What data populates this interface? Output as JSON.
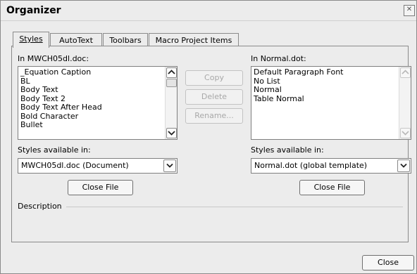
{
  "window": {
    "title": "Organizer",
    "close_icon": "close-icon"
  },
  "tabs": [
    {
      "label": "Styles",
      "active": true
    },
    {
      "label": "AutoText",
      "active": false
    },
    {
      "label": "Toolbars",
      "active": false
    },
    {
      "label": "Macro Project Items",
      "active": false
    }
  ],
  "left": {
    "list_label": "In MWCH05dl.doc:",
    "items": [
      "_Equation Caption",
      "BL",
      "Body Text",
      "Body Text 2",
      "Body Text After Head",
      "Bold Character",
      "Bullet"
    ],
    "available_label": "Styles available in:",
    "available_value": "MWCH05dl.doc (Document)",
    "close_file_label": "Close File"
  },
  "middle": {
    "copy_label": "Copy",
    "delete_label": "Delete",
    "rename_label": "Rename..."
  },
  "right": {
    "list_label": "In Normal.dot:",
    "items": [
      "Default Paragraph Font",
      "No List",
      "Normal",
      "Table Normal"
    ],
    "available_label": "Styles available in:",
    "available_value": "Normal.dot (global template)",
    "close_file_label": "Close File"
  },
  "description_label": "Description",
  "close_label": "Close"
}
